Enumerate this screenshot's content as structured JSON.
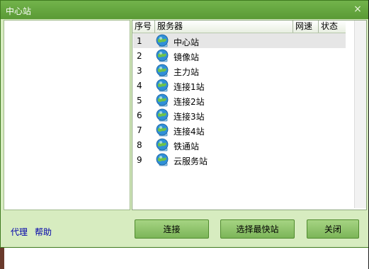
{
  "window": {
    "title": "中心站",
    "close_symbol": "×",
    "close_icon": "close-icon"
  },
  "server_list": {
    "columns": [
      "序号",
      "服务器",
      "网速",
      "状态"
    ],
    "rows": [
      {
        "num": "1",
        "name": "中心站",
        "speed": "",
        "status": "",
        "selected": true,
        "icon": "network-server-icon"
      },
      {
        "num": "2",
        "name": "镜像站",
        "speed": "",
        "status": "",
        "icon": "network-server-icon"
      },
      {
        "num": "3",
        "name": "主力站",
        "speed": "",
        "status": "",
        "icon": "network-server-icon"
      },
      {
        "num": "4",
        "name": "连接1站",
        "speed": "",
        "status": "",
        "icon": "network-server-icon"
      },
      {
        "num": "5",
        "name": "连接2站",
        "speed": "",
        "status": "",
        "icon": "network-server-icon"
      },
      {
        "num": "6",
        "name": "连接3站",
        "speed": "",
        "status": "",
        "icon": "network-server-icon"
      },
      {
        "num": "7",
        "name": "连接4站",
        "speed": "",
        "status": "",
        "icon": "network-server-icon"
      },
      {
        "num": "8",
        "name": "铁通站",
        "speed": "",
        "status": "",
        "icon": "network-server-icon"
      },
      {
        "num": "9",
        "name": "云服务站",
        "speed": "",
        "status": "",
        "icon": "network-server-icon"
      }
    ]
  },
  "footer": {
    "proxy_link": "代理",
    "help_link": "帮助",
    "connect_button": "连接",
    "fastest_button": "选择最快站",
    "close_button": "关闭"
  },
  "colors": {
    "titlebar": "#64a63e",
    "window_bg": "#d7ecc0",
    "button": "#8cc266",
    "link": "#0000aa",
    "selected_row": "#e6e6e6"
  }
}
